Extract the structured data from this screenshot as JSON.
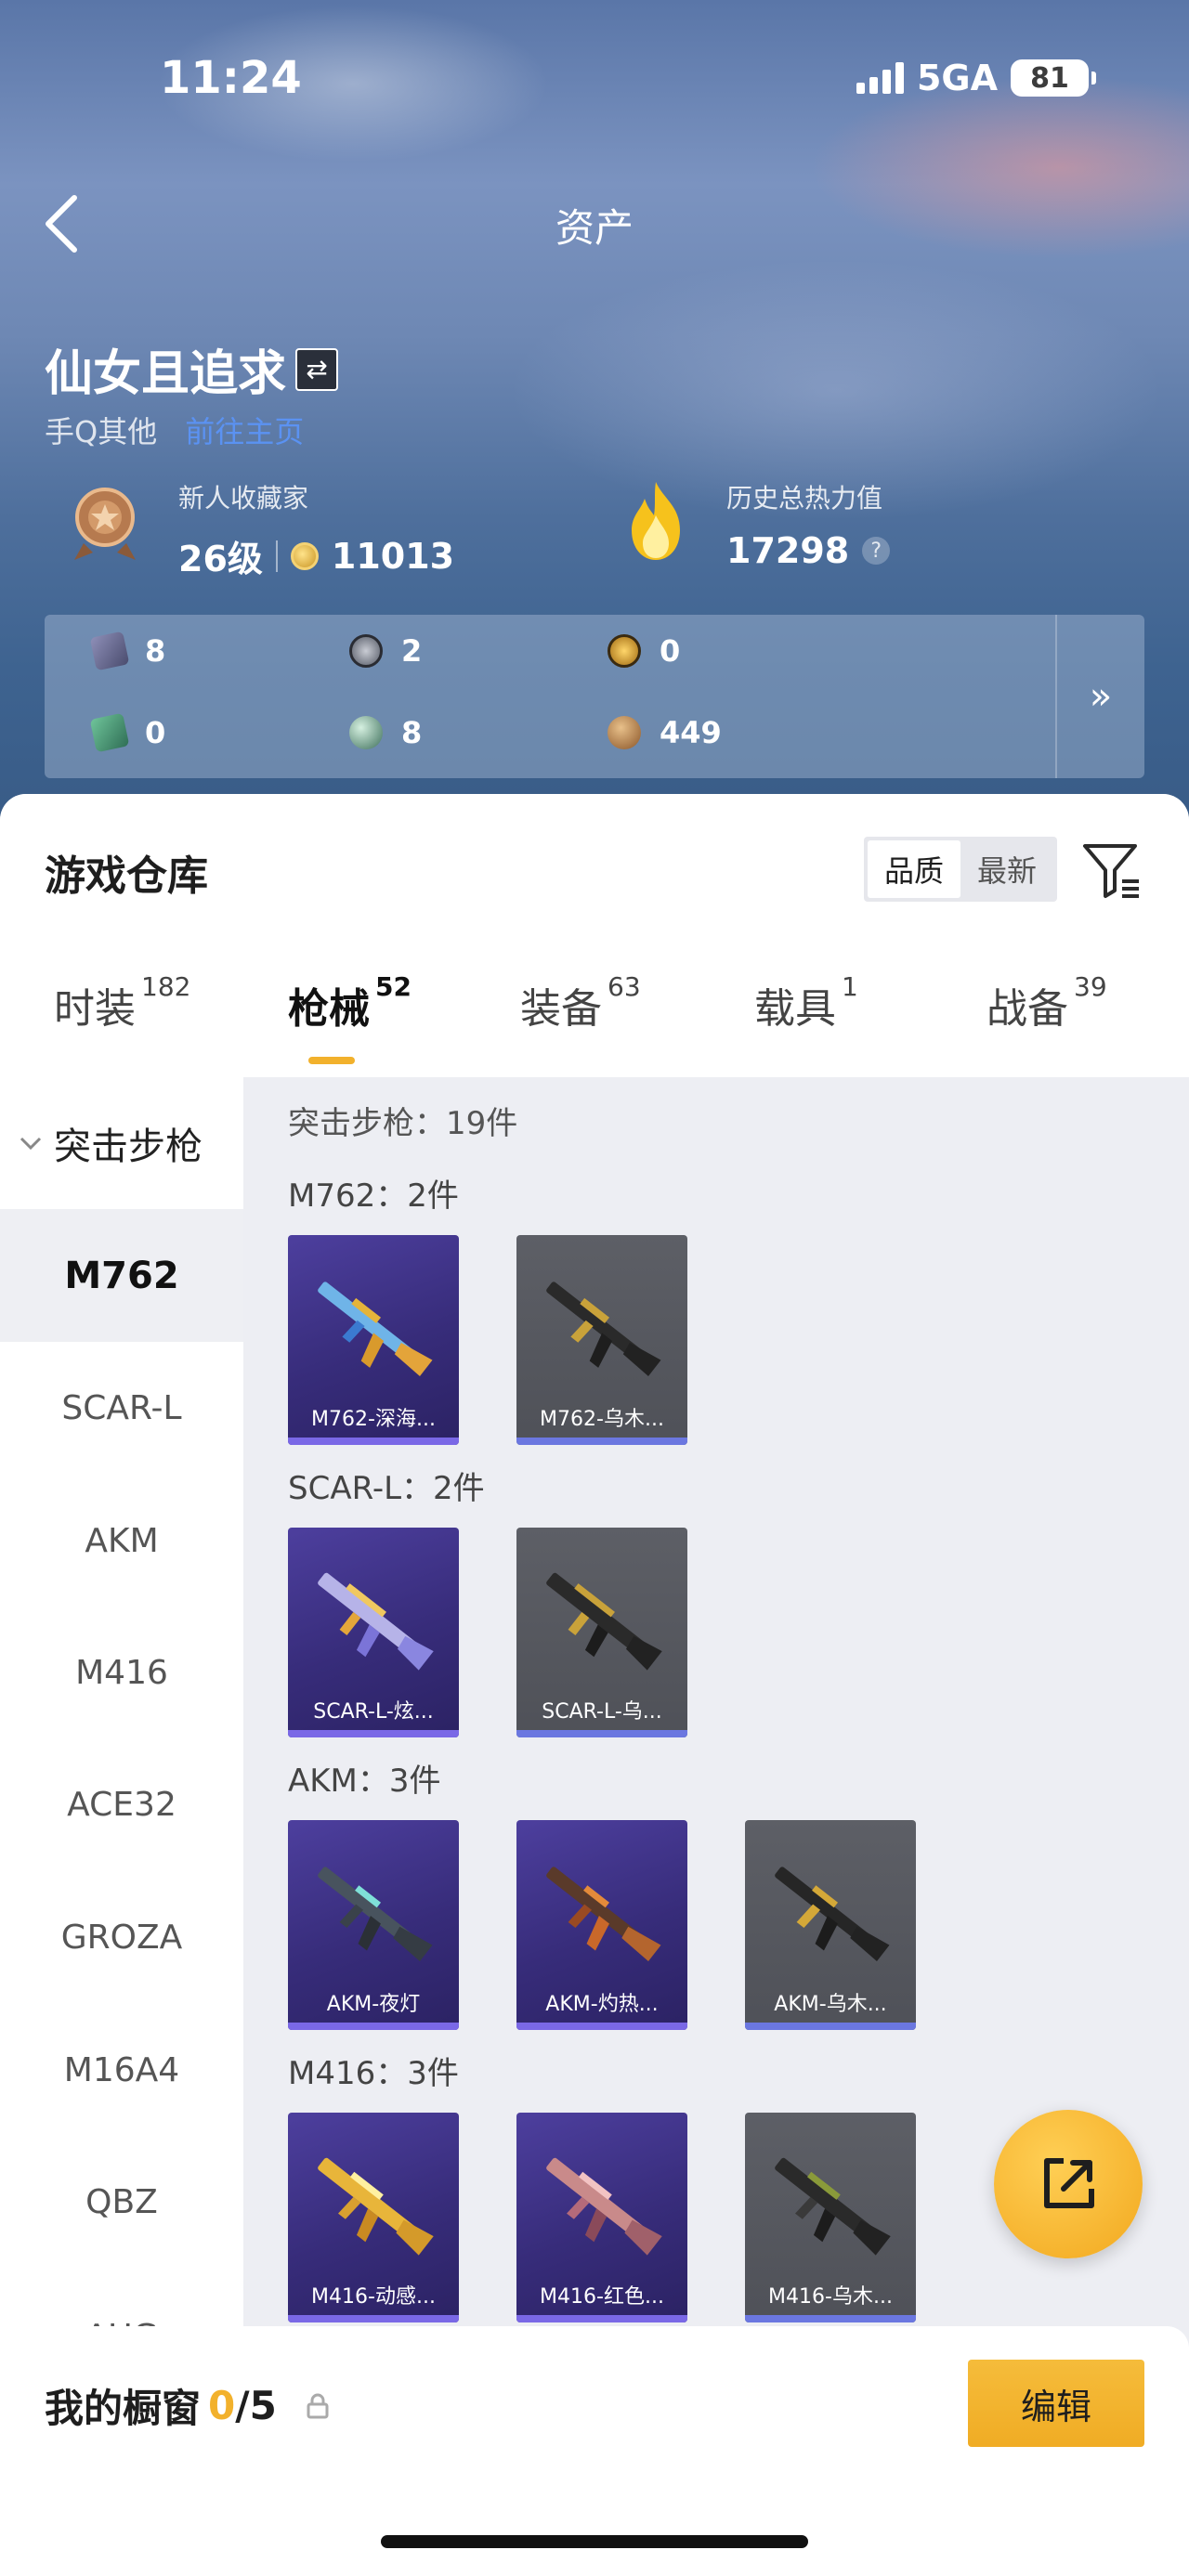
{
  "status_bar": {
    "time": "11:24",
    "network": "5GA",
    "battery": "81"
  },
  "header": {
    "title": "资产"
  },
  "profile": {
    "username": "仙女且追求",
    "platform": "手Q其他",
    "link_text": "前往主页",
    "collector_label": "新人收藏家",
    "level": "26级",
    "coins": "11013",
    "heat_label": "历史总热力值",
    "heat_value": "17298"
  },
  "resources": [
    {
      "icon": "purple-card-icon",
      "value": "8"
    },
    {
      "icon": "silver-token-icon",
      "value": "2"
    },
    {
      "icon": "gold-token-icon",
      "value": "0"
    },
    {
      "icon": "green-card-icon",
      "value": "0"
    },
    {
      "icon": "teal-orb-icon",
      "value": "8"
    },
    {
      "icon": "bronze-coin-icon",
      "value": "449"
    }
  ],
  "warehouse": {
    "title": "游戏仓库",
    "sort_options": [
      "品质",
      "最新"
    ],
    "sort_selected": "品质"
  },
  "tabs": [
    {
      "label": "时装",
      "count": "182"
    },
    {
      "label": "枪械",
      "count": "52"
    },
    {
      "label": "装备",
      "count": "63"
    },
    {
      "label": "载具",
      "count": "1"
    },
    {
      "label": "战备",
      "count": "39"
    }
  ],
  "sidebar": {
    "group": "突击步枪",
    "items": [
      "M762",
      "SCAR-L",
      "AKM",
      "M416",
      "ACE32",
      "GROZA",
      "M16A4",
      "QBZ",
      "AUG"
    ],
    "selected": "M762"
  },
  "grid": {
    "total": "突击步枪：19件",
    "groups": [
      {
        "label": "M762：2件",
        "items": [
          {
            "name": "M762-深海..."
          },
          {
            "name": "M762-乌木..."
          }
        ]
      },
      {
        "label": "SCAR-L：2件",
        "items": [
          {
            "name": "SCAR-L-炫..."
          },
          {
            "name": "SCAR-L-乌..."
          }
        ]
      },
      {
        "label": "AKM：3件",
        "items": [
          {
            "name": "AKM-夜灯"
          },
          {
            "name": "AKM-灼热..."
          },
          {
            "name": "AKM-乌木..."
          }
        ]
      },
      {
        "label": "M416：3件",
        "items": [
          {
            "name": "M416-动感..."
          },
          {
            "name": "M416-红色..."
          },
          {
            "name": "M416-乌木..."
          }
        ]
      }
    ]
  },
  "showcase": {
    "title": "我的橱窗",
    "current": "0",
    "total": "/5",
    "edit_label": "编辑"
  },
  "colors": {
    "accent": "#f2b12c",
    "purple_card": "#372c7a",
    "gray_card": "#55575e",
    "rarity_bar": "#7a68e6"
  }
}
